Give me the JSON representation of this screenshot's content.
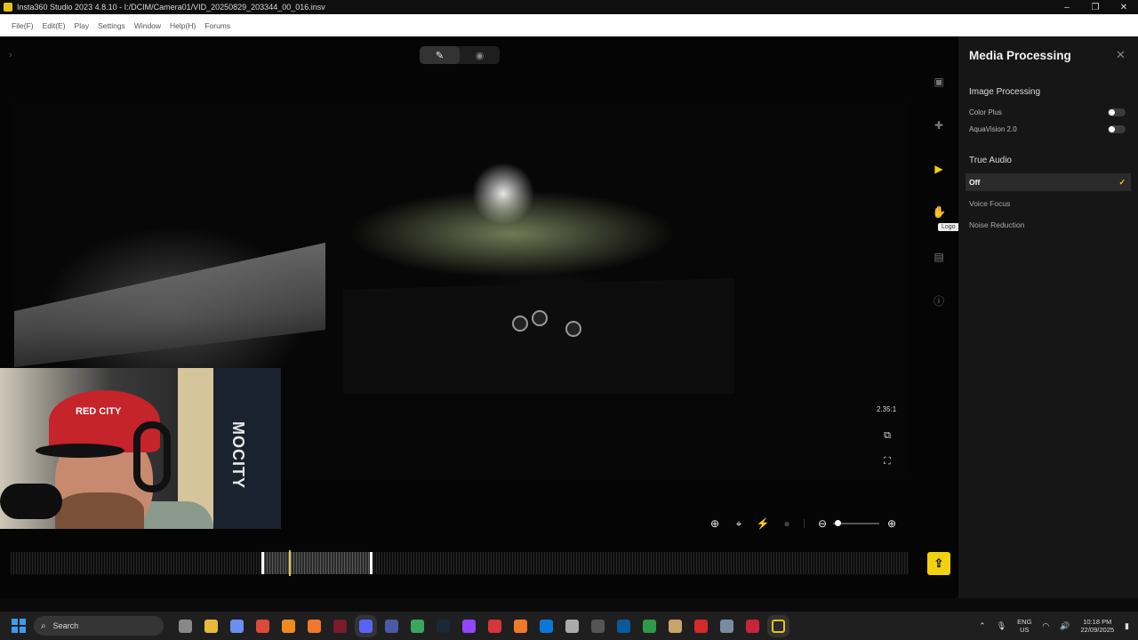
{
  "window": {
    "title": "Insta360 Studio 2023 4.8.10 - I:/DCIM/Camera01/VID_20250829_203344_00_016.insv",
    "controls": [
      "–",
      "❐",
      "✕"
    ]
  },
  "menu": {
    "items": [
      "File(F)",
      "Edit(E)",
      "Play",
      "Settings",
      "Window",
      "Help(H)",
      "Forums"
    ]
  },
  "viewer": {
    "aspect_ratio": "2.35:1"
  },
  "webcam": {
    "cap_text": "RED CITY",
    "poster_text": "MOCITY"
  },
  "sidebar": {
    "tooltip": "Logo",
    "active": "media-processing"
  },
  "panel": {
    "title": "Media Processing",
    "image_processing": {
      "title": "Image Processing",
      "options": [
        {
          "label": "Color Plus",
          "enabled": false
        },
        {
          "label": "AquaVision 2.0",
          "enabled": false
        }
      ]
    },
    "true_audio": {
      "title": "True Audio",
      "options": [
        "Off",
        "Voice Focus",
        "Noise Reduction"
      ],
      "selected": "Off"
    }
  },
  "taskbar": {
    "search_placeholder": "Search",
    "language": {
      "line1": "ENG",
      "line2": "US"
    },
    "time": "10:18 PM",
    "date": "22/09/2025"
  },
  "colors": {
    "accent": "#f2d20f",
    "panel_bg": "#161616",
    "windows_blue": "#3a9cf0"
  }
}
